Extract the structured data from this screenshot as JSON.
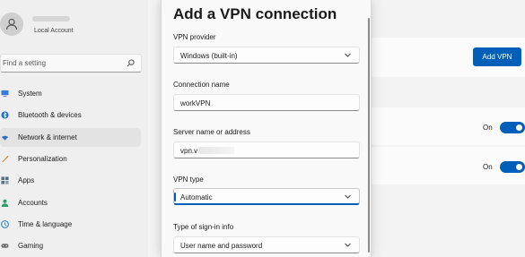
{
  "sidebar": {
    "account_label": "Local Account",
    "search_placeholder": "Find a setting",
    "items": [
      {
        "label": "System",
        "icon": "monitor-icon",
        "color": "#3a7bd5"
      },
      {
        "label": "Bluetooth & devices",
        "icon": "bluetooth-icon",
        "color": "#1a6fd0"
      },
      {
        "label": "Network & internet",
        "icon": "wifi-icon",
        "color": "#2a70c8",
        "active": true
      },
      {
        "label": "Personalization",
        "icon": "brush-icon",
        "color": "#d47a2a"
      },
      {
        "label": "Apps",
        "icon": "apps-icon",
        "color": "#5a6c86"
      },
      {
        "label": "Accounts",
        "icon": "person-icon",
        "color": "#2f9e6a"
      },
      {
        "label": "Time & language",
        "icon": "globe-clock-icon",
        "color": "#2a7fc8"
      },
      {
        "label": "Gaming",
        "icon": "gamepad-icon",
        "color": "#6a6a6a"
      }
    ]
  },
  "vpn_page": {
    "add_vpn_label": "Add VPN",
    "toggles": [
      {
        "label": "On",
        "on": true
      },
      {
        "label": "On",
        "on": true
      }
    ]
  },
  "dialog": {
    "title": "Add a VPN connection",
    "fields": {
      "provider": {
        "label": "VPN provider",
        "value": "Windows (built-in)"
      },
      "connection_name": {
        "label": "Connection name",
        "value": "workVPN"
      },
      "server": {
        "label": "Server name or address",
        "value": "vpn.v"
      },
      "vpn_type": {
        "label": "VPN type",
        "value": "Automatic"
      },
      "sign_in": {
        "label": "Type of sign-in info",
        "value": "User name and password"
      }
    }
  },
  "colors": {
    "accent": "#005fb8"
  }
}
